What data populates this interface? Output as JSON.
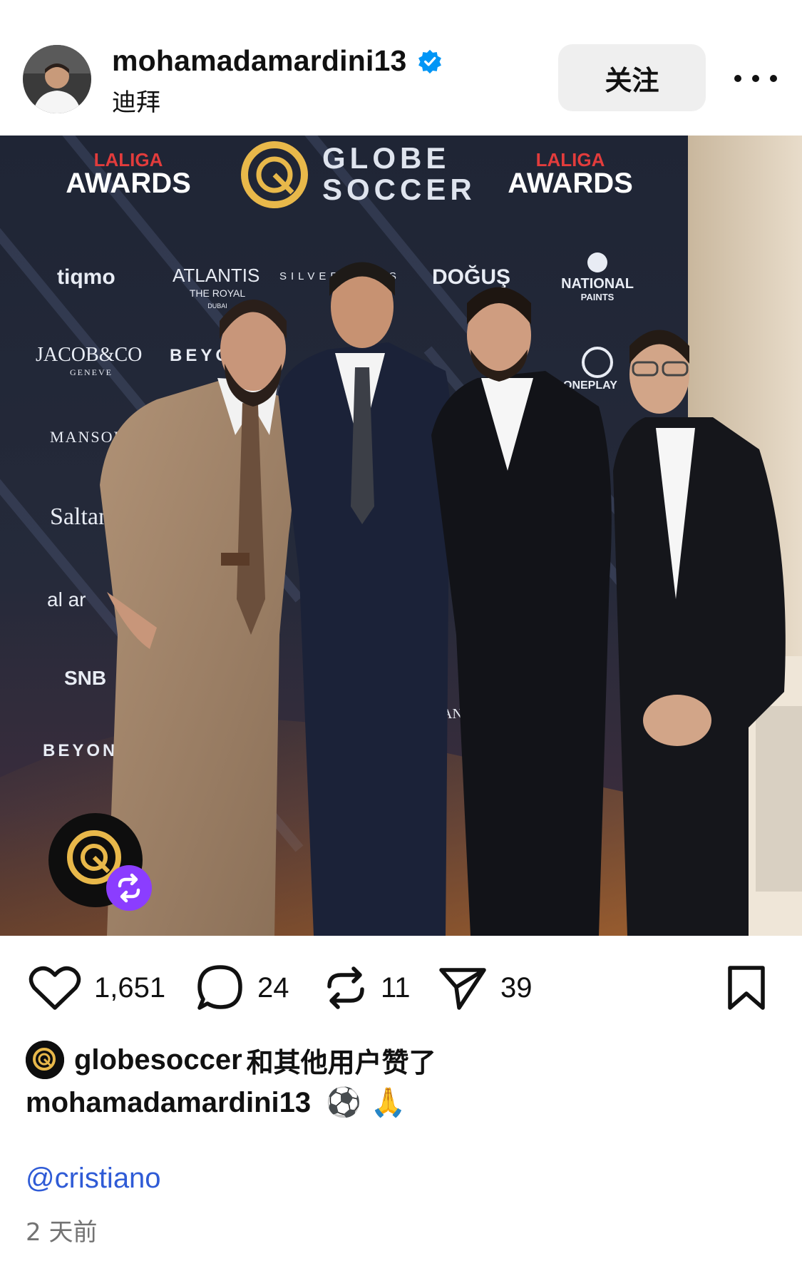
{
  "post_header": {
    "username": "mohamadamardini13",
    "location": "迪拜",
    "follow_label": "关注"
  },
  "photo": {
    "backdrop_texts": {
      "laliga_top": "LALIGA",
      "awards": "AWARDS",
      "globe": "GLOBE",
      "soccer": "SOCCER",
      "tiqmo": "tiqmo",
      "atlantis": "ATLANTIS",
      "atlantis_sub": "THE ROYAL",
      "atlantis_city": "DUBAI",
      "silversands": "SILVERSANDS",
      "dogus": "DOĞUŞ",
      "national": "NATIONAL",
      "paints": "PAINTS",
      "jacob": "JACOB&CO",
      "geneve": "GENEVE",
      "beyond": "BEYOND",
      "oneplay": "ONEPLAY",
      "mansory": "MANSORY",
      "saltanat": "Saltanat",
      "alar": "al ar",
      "snb": "SNB",
      "beyon2": "BEYON",
      "ansor": "ANSOR"
    }
  },
  "actions": {
    "likes": "1,651",
    "comments": "24",
    "reposts": "11",
    "shares": "39"
  },
  "liked_by": {
    "user": "globesoccer",
    "text": "和其他用户赞了"
  },
  "caption": {
    "user": "mohamadamardini13",
    "text": "⚽️ 🙏"
  },
  "mention": "@cristiano",
  "timestamp": "2 天前",
  "colors": {
    "verified": "#0095f6",
    "mention": "#2f5bd6",
    "repost_badge": "#8b3dff",
    "globe_gold": "#e8b84a"
  }
}
